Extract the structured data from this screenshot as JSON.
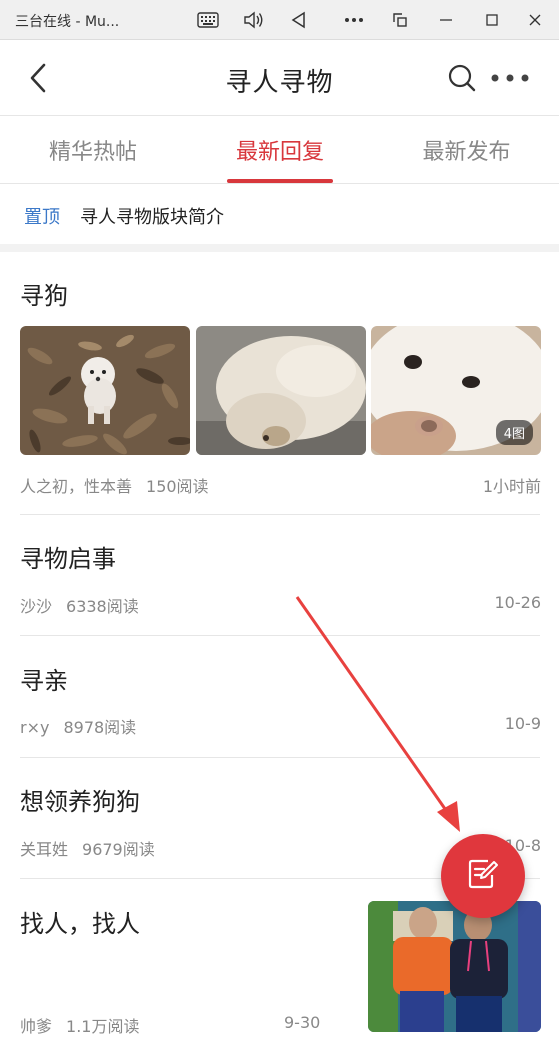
{
  "window": {
    "title": "三台在线 - Mu...",
    "controls": [
      "keyboard-icon",
      "volume-icon",
      "back-triangle-icon",
      "more-horizontal-icon",
      "screenshot-icon",
      "minimize-icon",
      "maximize-icon",
      "close-icon"
    ]
  },
  "header": {
    "title": "寻人寻物",
    "back_icon": "chevron-left-icon",
    "search_icon": "search-icon",
    "more_icon": "more-dots-icon"
  },
  "tabs": [
    {
      "label": "精华热帖",
      "active": false
    },
    {
      "label": "最新回复",
      "active": true
    },
    {
      "label": "最新发布",
      "active": false
    }
  ],
  "pinned": {
    "tag": "置顶",
    "title": "寻人寻物版块简介"
  },
  "posts": [
    {
      "title": "寻狗",
      "author": "人之初，性本善",
      "reads": "150阅读",
      "time": "1小时前",
      "images": [
        "dog-on-leaves",
        "dog-closeup-side",
        "dog-face-closeup"
      ],
      "image_count_badge": "4图"
    },
    {
      "title": "寻物启事",
      "author": "沙沙",
      "reads": "6338阅读",
      "time": "10-26"
    },
    {
      "title": "寻亲",
      "author": "r×y",
      "reads": "8978阅读",
      "time": "10-9"
    },
    {
      "title": "想领养狗狗",
      "author": "关耳姓",
      "reads": "9679阅读",
      "time": "10-8"
    },
    {
      "title": "找人，找人",
      "author": "帅爹",
      "reads": "1.1万阅读",
      "time": "9-30",
      "images": [
        "two-children-photo"
      ]
    }
  ],
  "fab": {
    "icon": "compose-icon"
  },
  "colors": {
    "accent": "#d8373c",
    "pin": "#3b78c8",
    "muted": "#888888",
    "annotation_arrow": "#e8413f"
  }
}
